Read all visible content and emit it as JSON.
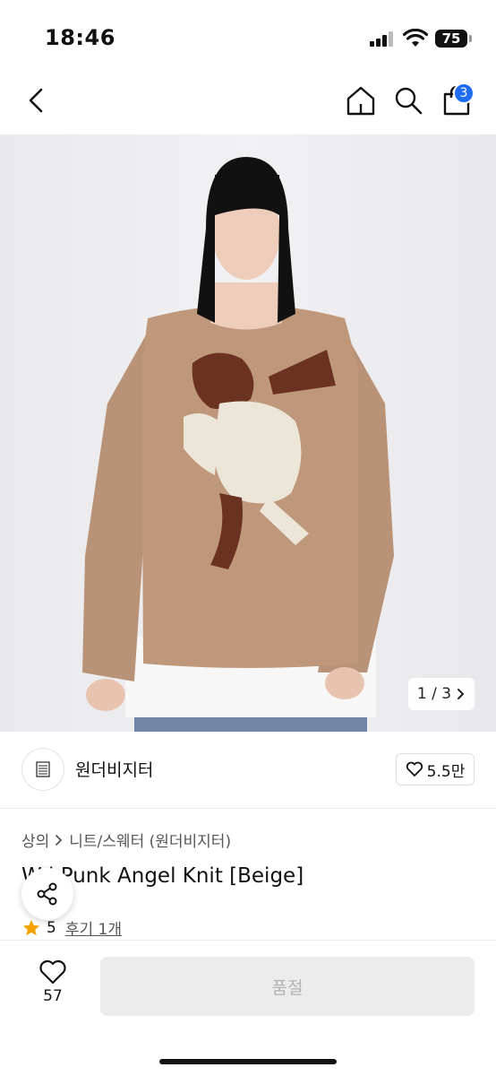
{
  "status_bar": {
    "time": "18:46",
    "battery": "75"
  },
  "nav": {
    "cart_count": "3"
  },
  "gallery": {
    "pager": "1 / 3"
  },
  "brand": {
    "name": "원더비지터",
    "likes": "5.5만"
  },
  "breadcrumb": {
    "category": "상의",
    "subcategory": "니트/스웨터 (원더비지터)"
  },
  "product": {
    "title_visible": "W    l Punk Angel Knit [Beige]",
    "rating": "5",
    "review_link": "후기 1개"
  },
  "bottom": {
    "wish_count": "57",
    "buy_label": "품절"
  },
  "colors": {
    "accent": "#1e6cf0",
    "star": "#f2a300",
    "sweater": "#b99378",
    "print_brown": "#6b3222",
    "print_cream": "#ece6d8"
  },
  "icons": [
    "back-icon",
    "home-icon",
    "search-icon",
    "bag-icon",
    "heart-icon",
    "share-icon",
    "star-icon",
    "chevron-right-icon"
  ]
}
